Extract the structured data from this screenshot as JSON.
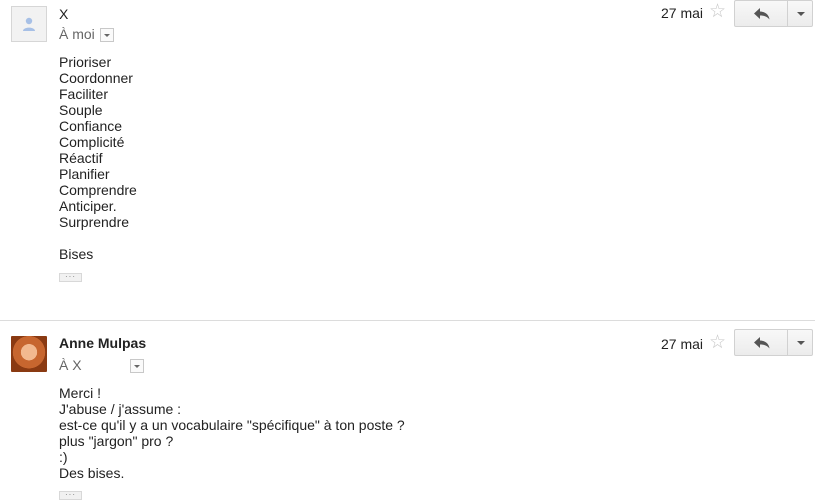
{
  "messages": [
    {
      "sender": "X",
      "recipient": "À moi",
      "date": "27 mai",
      "body_lines": [
        "Prioriser",
        "Coordonner",
        "Faciliter",
        "Souple",
        "Confiance",
        "Complicité",
        "Réactif",
        "Planifier",
        "Comprendre",
        "Anticiper.",
        "Surprendre",
        "",
        "Bises"
      ],
      "avatar_icon": "default-person-icon"
    },
    {
      "sender": "Anne Mulpas",
      "recipient": "À X",
      "date": "27 mai",
      "body_lines": [
        "Merci !",
        "J'abuse / j'assume :",
        "est-ce qu'il y a un vocabulaire \"spécifique\" à ton poste ?",
        "plus \"jargon\" pro ?",
        ":)",
        "Des bises."
      ],
      "avatar_icon": "user-photo"
    }
  ],
  "icons": {
    "star": "star-icon",
    "reply": "reply-arrow-icon",
    "more": "chevron-down-icon",
    "expand": "ellipsis-icon"
  },
  "colors": {
    "divider": "#dcdcdc",
    "button_border": "#d1d1d1",
    "muted_text": "#666666"
  }
}
